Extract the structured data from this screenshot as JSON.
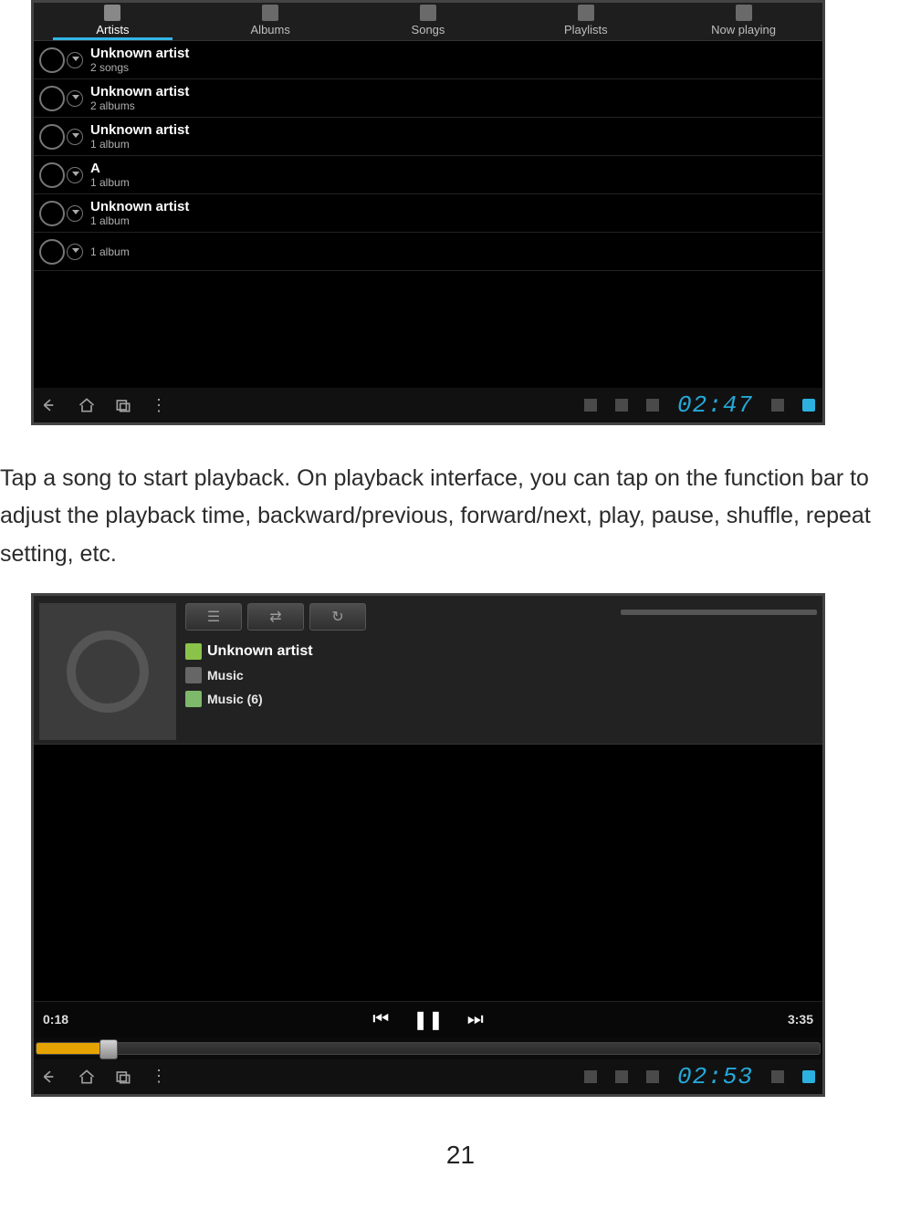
{
  "screenshot1": {
    "tabs": [
      {
        "label": "Artists",
        "active": true
      },
      {
        "label": "Albums",
        "active": false
      },
      {
        "label": "Songs",
        "active": false
      },
      {
        "label": "Playlists",
        "active": false
      },
      {
        "label": "Now playing",
        "active": false
      }
    ],
    "artists": [
      {
        "name": "Unknown artist",
        "sub": "2 songs"
      },
      {
        "name": "Unknown artist",
        "sub": "2 albums"
      },
      {
        "name": "Unknown artist",
        "sub": "1 album"
      },
      {
        "name": "A",
        "sub": "1 album"
      },
      {
        "name": "Unknown artist",
        "sub": "1 album"
      },
      {
        "name": "",
        "sub": "1 album"
      }
    ],
    "clock": "02:47"
  },
  "body_text": "Tap a song to start playback.   On playback interface, you can tap on the function bar to adjust the playback time, backward/previous, forward/next, play, pause, shuffle, repeat setting, etc.",
  "screenshot2": {
    "meta": {
      "artist": "Unknown artist",
      "album": "Music",
      "track": "Music (6)"
    },
    "time_elapsed": "0:18",
    "time_total": "3:35",
    "progress_pct": 8.4,
    "clock": "02:53"
  },
  "page_number": "21"
}
